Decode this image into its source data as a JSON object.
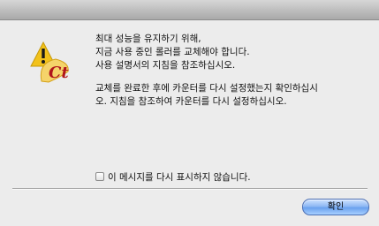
{
  "message": {
    "paragraph1": "최대 성능을 유지하기 위해,\n지금 사용 중인 롤러를 교체해야 합니다.\n사용 설명서의 지침을 참조하십시오.",
    "paragraph2": "교체를 완료한 후에 카운터를 다시 설정했는지 확인하십시\n오. 지침을 참조하여 카운터를 다시 설정하십시오."
  },
  "suppress_option": {
    "label": "이 메시지를 다시 표시하지 않습니다.",
    "checked": false
  },
  "buttons": {
    "ok_label": "확인"
  },
  "icon": {
    "name": "caution-icon",
    "badge_text": "Ct",
    "colors": {
      "triangle": "#f2c21b",
      "mark": "#1a1a1a",
      "badge_fill": "#f5d36a",
      "badge_text": "#b0151b"
    }
  }
}
